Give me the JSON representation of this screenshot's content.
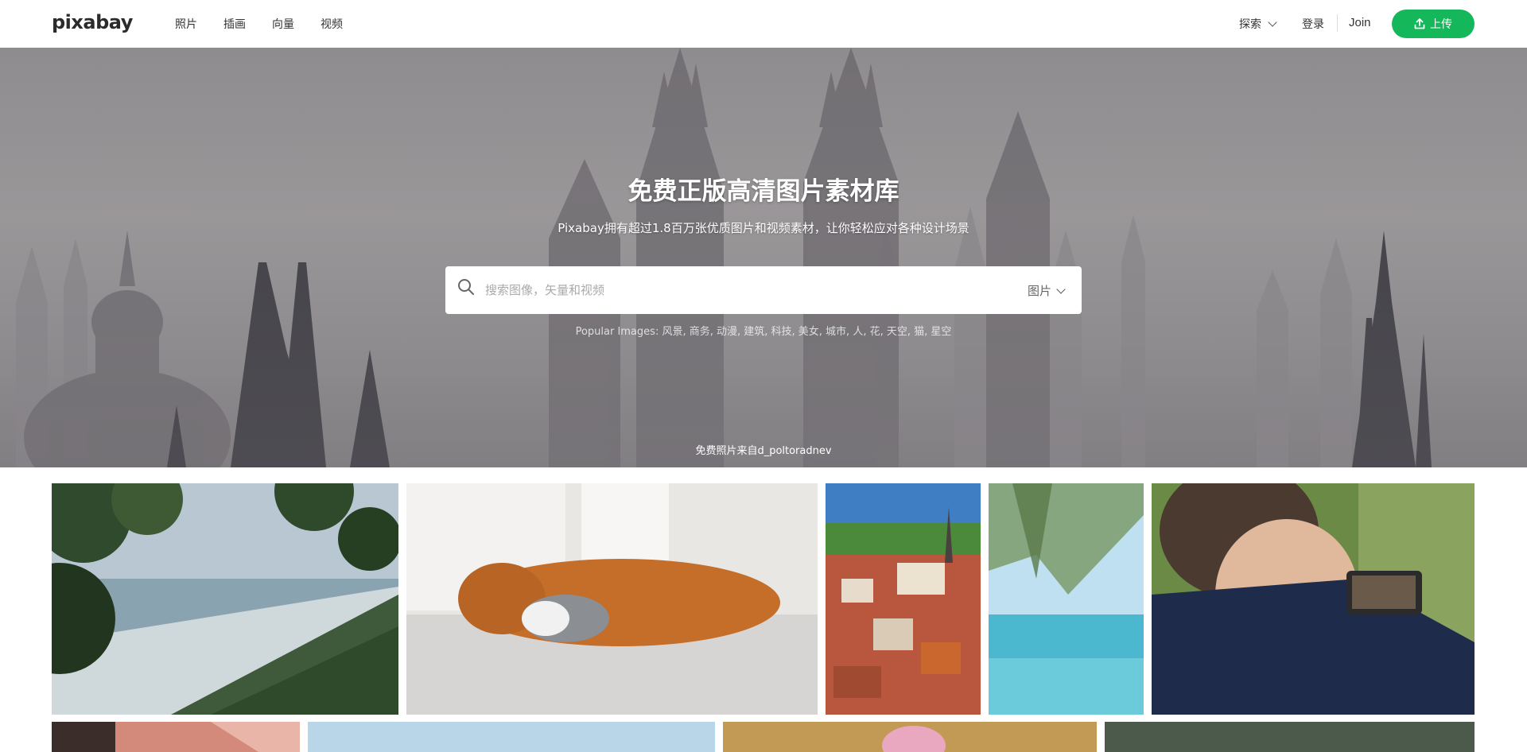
{
  "header": {
    "logo": "pixabay",
    "nav": [
      "照片",
      "插画",
      "向量",
      "视频"
    ],
    "explore_label": "探索",
    "login_label": "登录",
    "join_label": "Join",
    "upload_label": "上传"
  },
  "hero": {
    "title": "免费正版高清图片素材库",
    "subtitle": "Pixabay拥有超过1.8百万张优质图片和视频素材，让你轻松应对各种设计场景",
    "search": {
      "placeholder": "搜索图像，矢量和视频",
      "type_label": "图片"
    },
    "popular": "Popular Images: 风景, 商务, 动漫, 建筑, 科技, 美女, 城市, 人, 花, 天空, 猫, 星空",
    "credit": "免费照片来自d_poltoradnev"
  },
  "colors": {
    "brand_green": "#14b85b"
  },
  "icons": {
    "search": "search-icon",
    "upload": "upload-icon",
    "chevron": "chevron-down-icon"
  }
}
